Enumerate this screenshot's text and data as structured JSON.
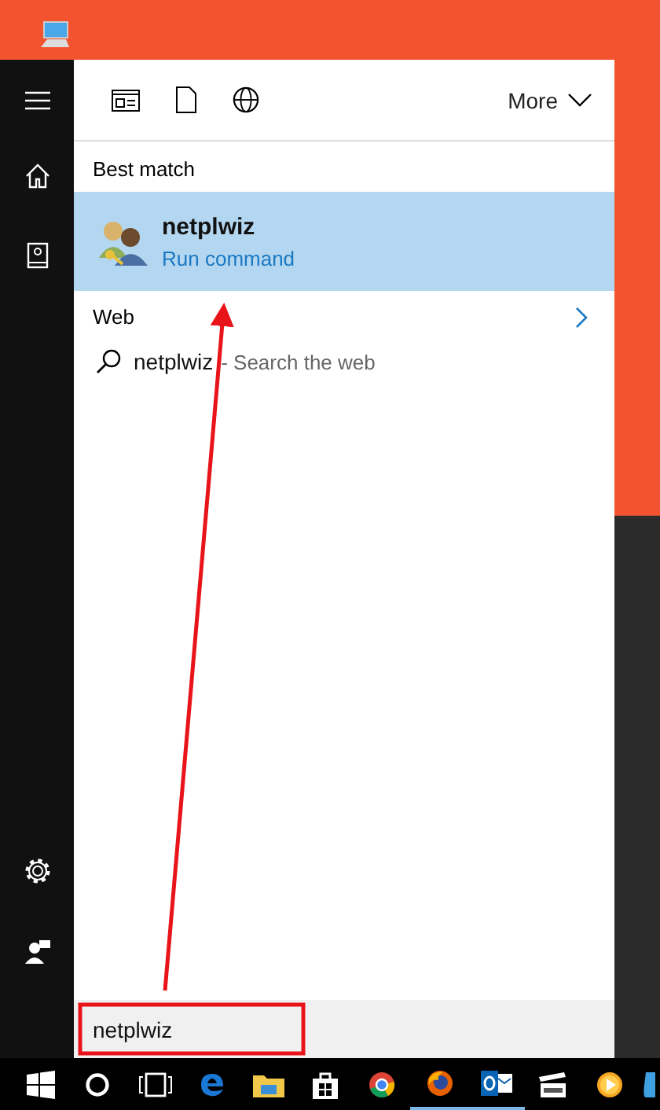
{
  "toolbar": {
    "more": "More"
  },
  "best_match": {
    "heading": "Best match",
    "result": {
      "title": "netplwiz",
      "subtitle": "Run command",
      "selected": true
    }
  },
  "web": {
    "heading": "Web",
    "suggestion": {
      "query": "netplwiz",
      "hint": "- Search the web"
    }
  },
  "search_box": {
    "value": "netplwiz"
  },
  "taskbar": {
    "apps": [
      {
        "kind": "start",
        "running": false
      },
      {
        "kind": "cortana",
        "running": false
      },
      {
        "kind": "taskview",
        "running": false
      },
      {
        "kind": "edge",
        "running": false
      },
      {
        "kind": "explorer",
        "running": false
      },
      {
        "kind": "store",
        "running": false
      },
      {
        "kind": "chrome",
        "running": false
      },
      {
        "kind": "firefox",
        "running": true
      },
      {
        "kind": "outlook",
        "running": true
      },
      {
        "kind": "moviemaker",
        "running": false
      },
      {
        "kind": "player",
        "running": false
      },
      {
        "kind": "partial",
        "running": false
      }
    ]
  }
}
